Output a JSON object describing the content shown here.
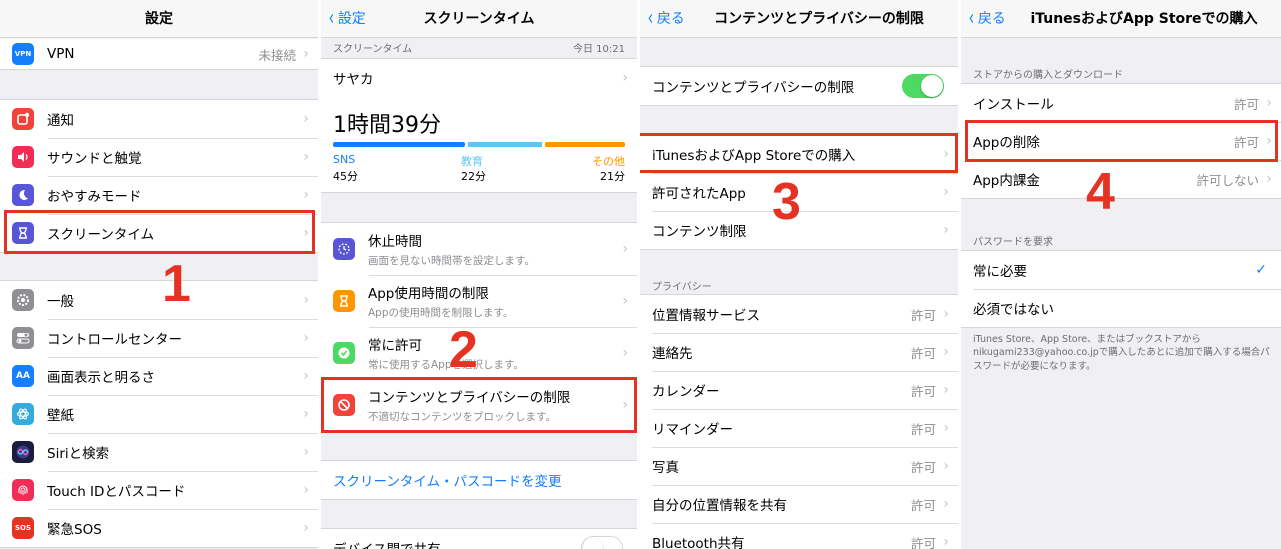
{
  "panel1": {
    "title": "設定",
    "vpn": {
      "label": "VPN",
      "icon_text": "VPN",
      "value": "未接続"
    },
    "group2": [
      {
        "label": "通知",
        "icon": "notification-icon",
        "color": "#f0433a"
      },
      {
        "label": "サウンドと触覚",
        "icon": "speaker-icon",
        "color": "#f22d55"
      },
      {
        "label": "おやすみモード",
        "icon": "moon-icon",
        "color": "#5856d6"
      },
      {
        "label": "スクリーンタイム",
        "icon": "hourglass-icon",
        "color": "#5856d6"
      }
    ],
    "group3": [
      {
        "label": "一般",
        "icon": "gear-icon",
        "color": "#8e8e93"
      },
      {
        "label": "コントロールセンター",
        "icon": "toggles-icon",
        "color": "#8e8e93"
      },
      {
        "label": "画面表示と明るさ",
        "icon": "text-size-icon",
        "icon_text": "AA",
        "color": "#147efb"
      },
      {
        "label": "壁紙",
        "icon": "flower-icon",
        "color": "#35aadc"
      },
      {
        "label": "Siriと検索",
        "icon": "siri-icon",
        "color": "#1c1c3c"
      },
      {
        "label": "Touch IDとパスコード",
        "icon": "fingerprint-icon",
        "color": "#f22d55"
      },
      {
        "label": "緊急SOS",
        "icon": "sos-icon",
        "icon_text": "SOS",
        "color": "#e53323"
      }
    ],
    "step": "1"
  },
  "panel2": {
    "back": "設定",
    "title": "スクリーンタイム",
    "header_left": "スクリーンタイム",
    "header_right": "今日 10:21",
    "user": "サヤカ",
    "total_time": "1時間39分",
    "categories": [
      {
        "name": "SNS",
        "time": "45分",
        "color": "#147efb"
      },
      {
        "name": "教育",
        "time": "22分",
        "color": "#5ac8fa"
      },
      {
        "name": "その他",
        "time": "21分",
        "color": "#ff9500"
      }
    ],
    "items": [
      {
        "title": "休止時間",
        "subtitle": "画面を見ない時間帯を設定します。",
        "icon": "downtime-icon",
        "color": "#5856d6"
      },
      {
        "title": "App使用時間の制限",
        "subtitle": "Appの使用時間を制限します。",
        "icon": "hourglass-icon",
        "color": "#ff9500"
      },
      {
        "title": "常に許可",
        "subtitle": "常に使用するAppを選択します。",
        "icon": "checkmark-badge-icon",
        "color": "#4cd964"
      },
      {
        "title": "コンテンツとプライバシーの制限",
        "subtitle": "不適切なコンテンツをブロックします。",
        "icon": "restricted-icon",
        "color": "#f0433a"
      }
    ],
    "change_passcode": "スクリーンタイム・パスコードを変更",
    "share": "デバイス間で共有",
    "step": "2"
  },
  "panel3": {
    "back": "戻る",
    "title": "コンテンツとプライバシーの制限",
    "toggle_label": "コンテンツとプライバシーの制限",
    "items": [
      "iTunesおよびApp Storeでの購入",
      "許可されたApp",
      "コンテンツ制限"
    ],
    "privacy_header": "プライバシー",
    "privacy": [
      {
        "label": "位置情報サービス",
        "value": "許可"
      },
      {
        "label": "連絡先",
        "value": "許可"
      },
      {
        "label": "カレンダー",
        "value": "許可"
      },
      {
        "label": "リマインダー",
        "value": "許可"
      },
      {
        "label": "写真",
        "value": "許可"
      },
      {
        "label": "自分の位置情報を共有",
        "value": "許可"
      },
      {
        "label": "Bluetooth共有",
        "value": "許可"
      }
    ],
    "step": "3"
  },
  "panel4": {
    "back": "戻る",
    "title": "iTunesおよびApp Storeでの購入",
    "section1": "ストアからの購入とダウンロード",
    "items": [
      {
        "label": "インストール",
        "value": "許可"
      },
      {
        "label": "Appの削除",
        "value": "許可"
      },
      {
        "label": "App内課金",
        "value": "許可しない"
      }
    ],
    "section2": "パスワードを要求",
    "password_options": [
      "常に必要",
      "必須ではない"
    ],
    "footer": "iTunes Store、App Store、またはブックストアから nikugami233@yahoo.co.jpで購入したあとに追加で購入する場合パスワードが必要になります。",
    "step": "4"
  }
}
